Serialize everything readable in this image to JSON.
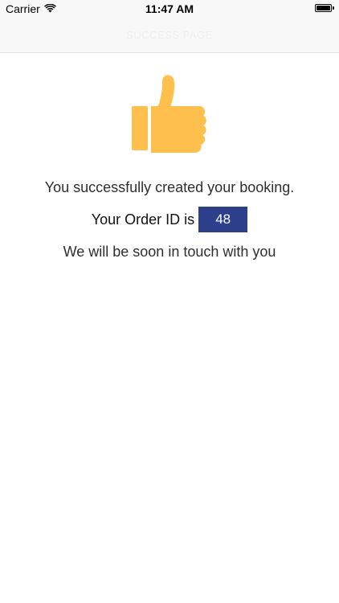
{
  "status_bar": {
    "carrier": "Carrier",
    "time": "11:47 AM",
    "wifi_icon": "wifi-icon",
    "battery_icon": "battery-icon"
  },
  "nav": {
    "title": "SUCCESS PAGE"
  },
  "content": {
    "thumb_icon": "thumbs-up-icon",
    "thumb_color": "#FFBF4D",
    "success_message": "You successfully created your booking.",
    "order_label": "Your Order ID is",
    "order_id": "48",
    "order_badge_color": "#2D3E8B",
    "contact_message": "We will be soon in touch with you"
  }
}
